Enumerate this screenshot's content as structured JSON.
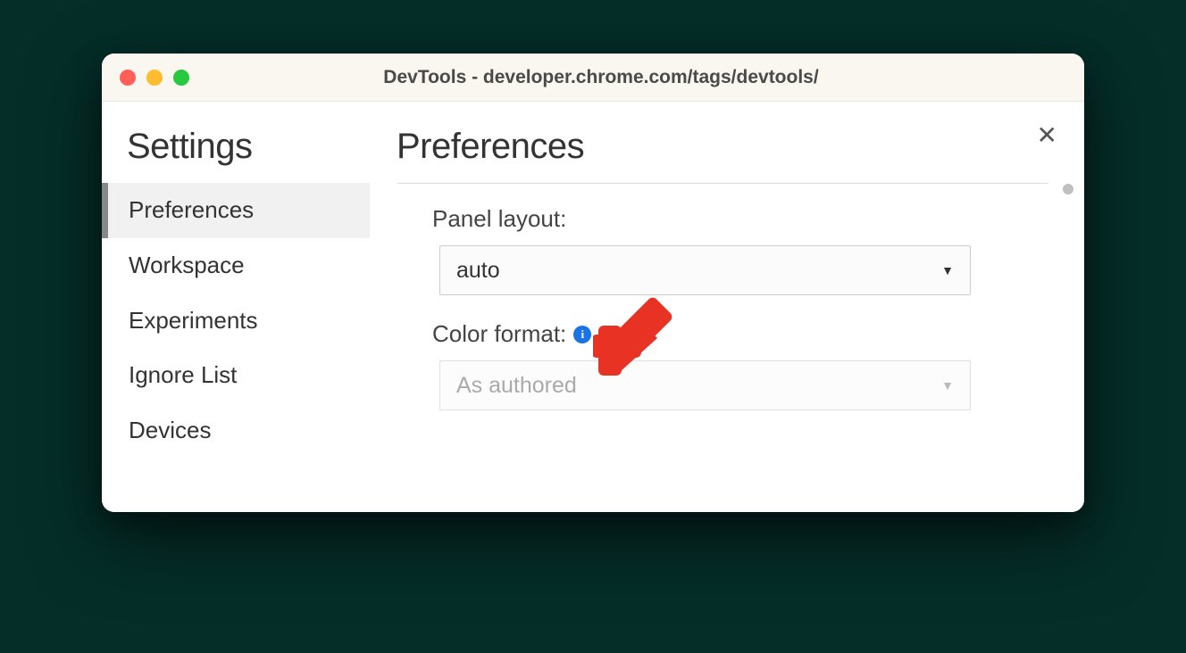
{
  "window": {
    "title": "DevTools - developer.chrome.com/tags/devtools/"
  },
  "sidebar": {
    "title": "Settings",
    "items": [
      {
        "label": "Preferences",
        "selected": true
      },
      {
        "label": "Workspace",
        "selected": false
      },
      {
        "label": "Experiments",
        "selected": false
      },
      {
        "label": "Ignore List",
        "selected": false
      },
      {
        "label": "Devices",
        "selected": false
      }
    ]
  },
  "main": {
    "title": "Preferences",
    "settings": {
      "panel_layout": {
        "label": "Panel layout:",
        "value": "auto"
      },
      "color_format": {
        "label": "Color format:",
        "value": "As authored",
        "has_info": true,
        "disabled": true
      }
    }
  },
  "annotation": {
    "color": "#e73224"
  }
}
